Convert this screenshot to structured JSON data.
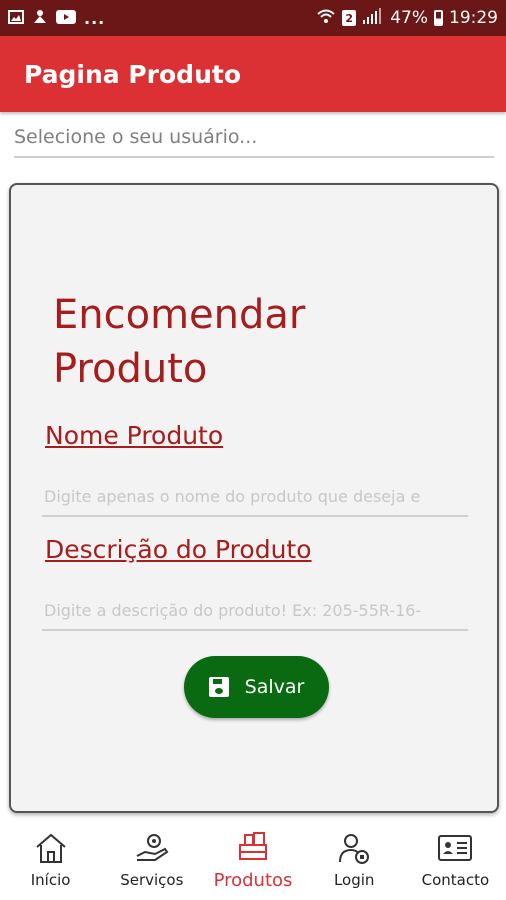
{
  "status_bar": {
    "dots": "...",
    "sim_slot": "2",
    "battery": "47%",
    "time": "19:29"
  },
  "app_bar": {
    "title": "Pagina Produto"
  },
  "user_select": {
    "placeholder": "Selecione o seu usuário..."
  },
  "form": {
    "title": "Encomendar Produto",
    "name_label": "Nome Produto",
    "name_placeholder": "Digite apenas o nome do produto que deseja e",
    "description_label": "Descrição do Produto",
    "description_placeholder": "Digite a descrição do produto! Ex: 205-55R-16-",
    "save_label": "Salvar"
  },
  "bottom_nav": {
    "items": [
      {
        "label": "Início",
        "icon": "home-icon",
        "active": false
      },
      {
        "label": "Serviços",
        "icon": "services-icon",
        "active": false
      },
      {
        "label": "Produtos",
        "icon": "products-icon",
        "active": true
      },
      {
        "label": "Login",
        "icon": "login-icon",
        "active": false
      },
      {
        "label": "Contacto",
        "icon": "contact-icon",
        "active": false
      }
    ],
    "active_color": "#dc3134"
  },
  "colors": {
    "accent": "#dc3134",
    "status_bar": "#6b1717",
    "title_text": "#a51d1d",
    "save_button": "#0a6a11"
  }
}
